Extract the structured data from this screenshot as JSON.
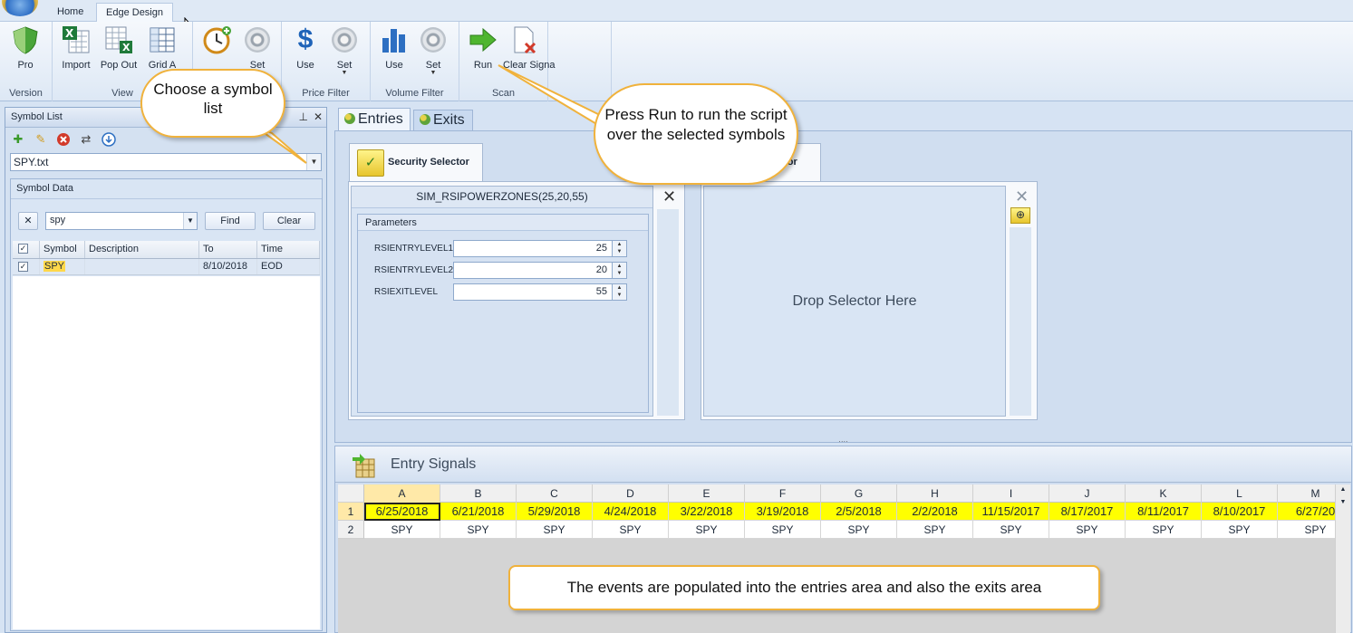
{
  "ribbon": {
    "tabs": [
      "Home",
      "Edge Design"
    ],
    "groups": [
      {
        "label": "Version",
        "buttons": [
          "Pro"
        ]
      },
      {
        "label": "View",
        "buttons": [
          "Import",
          "Pop Out",
          "Grid A"
        ]
      },
      {
        "label": "",
        "buttons": [
          "",
          "Set"
        ]
      },
      {
        "label": "Price Filter",
        "buttons": [
          "Use",
          "Set"
        ]
      },
      {
        "label": "Volume Filter",
        "buttons": [
          "Use",
          "Set"
        ]
      },
      {
        "label": "Scan",
        "buttons": [
          "Run",
          "Clear Signa"
        ]
      }
    ]
  },
  "symbol_list": {
    "title": "Symbol List",
    "selected_list": "SPY.txt",
    "symbol_data": {
      "title": "Symbol Data",
      "search_value": "spy",
      "find_label": "Find",
      "clear_label": "Clear",
      "columns": [
        "Symbol",
        "Description",
        "To",
        "Time"
      ],
      "rows": [
        {
          "symbol": "SPY",
          "description": "",
          "to": "8/10/2018",
          "time": "EOD",
          "checked": true
        }
      ]
    }
  },
  "doc_tabs": [
    "Entries",
    "Exits"
  ],
  "security_selector": {
    "tab_label": "Security Selector",
    "tab2_label_visible": "ctor",
    "script_title": "SIM_RSIPOWERZONES(25,20,55)",
    "parameters_title": "Parameters",
    "parameters": [
      {
        "name": "RSIENTRYLEVEL1",
        "value": "25"
      },
      {
        "name": "RSIENTRYLEVEL2",
        "value": "20"
      },
      {
        "name": "RSIEXITLEVEL",
        "value": "55"
      }
    ],
    "drop_text": "Drop Selector Here"
  },
  "entry_signals": {
    "title": "Entry Signals",
    "columns": [
      "A",
      "B",
      "C",
      "D",
      "E",
      "F",
      "G",
      "H",
      "I",
      "J",
      "K",
      "L",
      "M"
    ],
    "row_numbers": [
      "1",
      "2"
    ],
    "dates": [
      "6/25/2018",
      "6/21/2018",
      "5/29/2018",
      "4/24/2018",
      "3/22/2018",
      "3/19/2018",
      "2/5/2018",
      "2/2/2018",
      "11/15/2017",
      "8/17/2017",
      "8/11/2017",
      "8/10/2017",
      "6/27/20"
    ],
    "symbols": [
      "SPY",
      "SPY",
      "SPY",
      "SPY",
      "SPY",
      "SPY",
      "SPY",
      "SPY",
      "SPY",
      "SPY",
      "SPY",
      "SPY",
      "SPY"
    ]
  },
  "callouts": {
    "choose_list": "Choose a symbol list",
    "press_run": "Press Run to run the script over the selected symbols",
    "events": "The events are populated into the entries area and also the exits area"
  },
  "colors": {
    "callout_border": "#f0b23c",
    "date_highlight": "#ffff00",
    "ribbon_bg": "#dde8f5"
  }
}
